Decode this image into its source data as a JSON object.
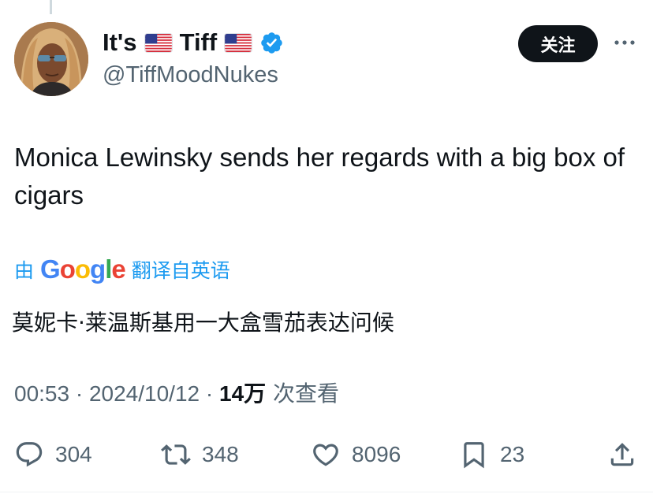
{
  "tweet": {
    "author": {
      "name_prefix": "It's",
      "name_suffix": "Tiff",
      "handle": "@TiffMoodNukes",
      "avatar_icon": "user-avatar-photo",
      "flag_icon": "us-flag-icon",
      "verified_icon": "verified-badge-icon"
    },
    "follow_label": "关注",
    "more_icon": "more-options-icon",
    "text": "Monica Lewinsky sends her regards with a big box of cigars",
    "translation": {
      "by_label": "由",
      "provider": "Google",
      "from_label": "翻译自英语",
      "text": "莫妮卡·莱温斯基用一大盒雪茄表达问候"
    },
    "meta": {
      "time": "00:53",
      "separator": " · ",
      "date": "2024/10/12",
      "views_count": "14万",
      "views_label": " 次查看"
    },
    "actions": {
      "replies": "304",
      "retweets": "348",
      "likes": "8096",
      "bookmarks": "23"
    }
  },
  "colors": {
    "accent_blue": "#1d9bf0",
    "text_primary": "#0f1419",
    "text_secondary": "#536471",
    "button_dark": "#0f1419",
    "google_blue": "#4285F4",
    "google_red": "#EA4335",
    "google_yellow": "#FBBC05",
    "google_green": "#34A853"
  }
}
